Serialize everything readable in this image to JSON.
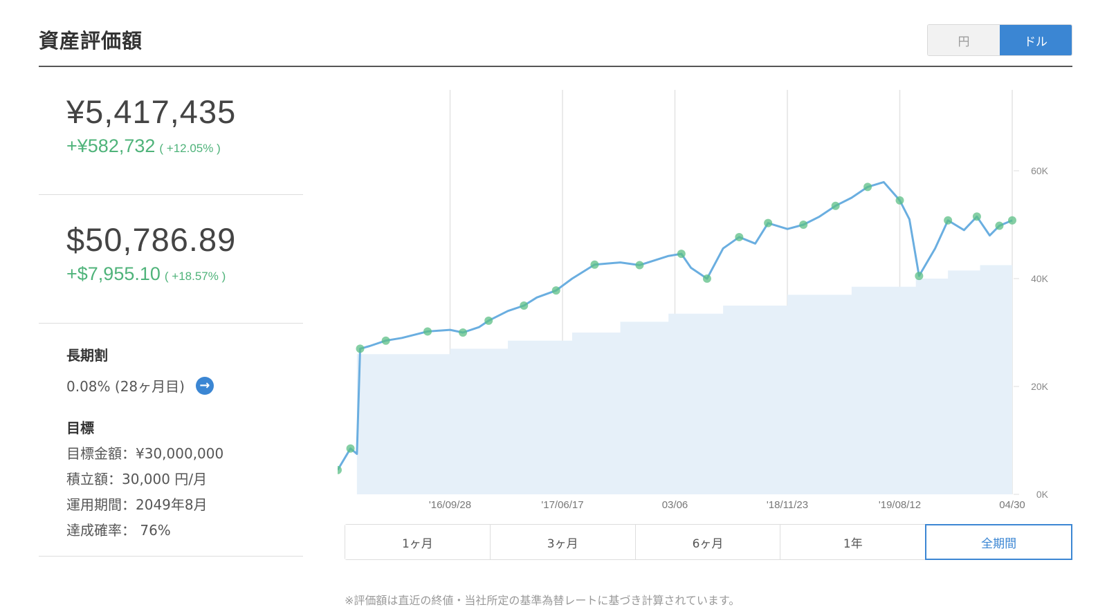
{
  "header": {
    "title": "資産評価額",
    "currency_options": [
      {
        "label": "円",
        "selected": false
      },
      {
        "label": "ドル",
        "selected": true
      }
    ]
  },
  "summary": {
    "yen": {
      "amount": "¥5,417,435",
      "gain": "+¥582,732",
      "gain_pct": "( +12.05% )"
    },
    "usd": {
      "amount": "$50,786.89",
      "gain": "+$7,955.10",
      "gain_pct": "( +18.57% )"
    }
  },
  "long_term_discount": {
    "label": "長期割",
    "value": "0.08% (28ヶ月目)"
  },
  "goal": {
    "label": "目標",
    "lines": [
      "目標金額：¥30,000,000",
      "積立額：30,000 円/月",
      "運用期間：2049年8月",
      "達成確率： 76%"
    ]
  },
  "period_tabs": [
    {
      "label": "1ヶ月",
      "active": false
    },
    {
      "label": "3ヶ月",
      "active": false
    },
    {
      "label": "6ヶ月",
      "active": false
    },
    {
      "label": "1年",
      "active": false
    },
    {
      "label": "全期間",
      "active": true
    }
  ],
  "footnote": "※評価額は直近の終値・当社所定の基準為替レートに基づき計算されています。",
  "colors": {
    "accent": "#3b86d3",
    "gain": "#4fb37a",
    "value_line": "#6aaee0",
    "principal_fill": "#e6f0f9",
    "marker": "#5cbf86"
  },
  "chart_data": {
    "type": "area",
    "x_tick_labels": [
      "'16/09/28",
      "'17/06/17",
      "03/06",
      "'18/11/23",
      "'19/08/12",
      "04/30"
    ],
    "y_tick_labels": [
      "60K",
      "40K",
      "20K",
      "0K"
    ],
    "ylim": [
      0,
      75000
    ],
    "grid": "vertical",
    "series": [
      {
        "kind": "line",
        "x": [
          0.0,
          0.4,
          0.6,
          0.7,
          1.0,
          1.5,
          2.0,
          2.8,
          3.5,
          3.9,
          4.4,
          4.7,
          5.3,
          5.8,
          6.2,
          6.8,
          7.3,
          8.0,
          8.8,
          9.4,
          10.3,
          10.7,
          11.0,
          11.5,
          12.0,
          12.5,
          13.0,
          13.4,
          14.0,
          14.5,
          15.0,
          15.5,
          16.0,
          16.5,
          17.0,
          17.5,
          17.8,
          18.1,
          18.6,
          19.0,
          19.5,
          19.9,
          20.3,
          20.6,
          20.8,
          21.0
        ],
        "y": [
          4500,
          8500,
          7500,
          27000,
          27500,
          28500,
          29000,
          30200,
          30500,
          30000,
          31000,
          32200,
          34000,
          35000,
          36500,
          37800,
          40000,
          42600,
          43000,
          42500,
          44200,
          44600,
          42000,
          40000,
          45600,
          47700,
          46500,
          50300,
          49200,
          50000,
          51500,
          53500,
          55000,
          57000,
          57900,
          54500,
          51000,
          40500,
          45600,
          50800,
          49000,
          51500,
          48000,
          49800,
          50300,
          50800
        ]
      },
      {
        "kind": "area",
        "x": [
          0.0,
          0.5,
          0.6,
          2.0,
          2.8,
          3.5,
          5.3,
          7.3,
          8.8,
          10.3,
          12.0,
          14.0,
          16.0,
          18.0,
          19.0,
          20.0,
          21.0
        ],
        "y": [
          0,
          0,
          26000,
          26000,
          26000,
          27000,
          28500,
          30000,
          32000,
          33500,
          35000,
          37000,
          38500,
          40000,
          41500,
          42500,
          42800
        ]
      }
    ]
  }
}
